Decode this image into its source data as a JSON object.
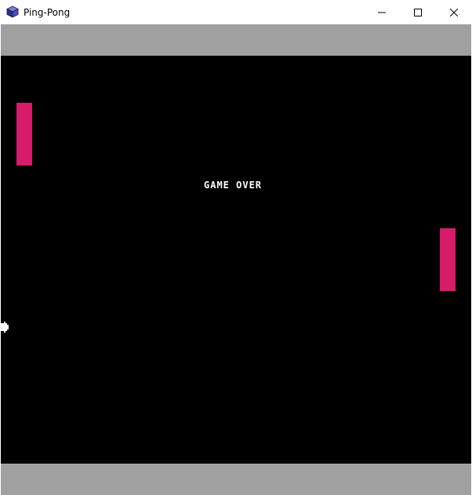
{
  "window": {
    "title": "Ping-Pong",
    "icon": "cube-app-icon"
  },
  "controls": {
    "minimize_icon": "minimize-icon",
    "maximize_icon": "maximize-icon",
    "close_icon": "close-icon"
  },
  "game": {
    "status_text": "GAME OVER",
    "colors": {
      "background": "#000000",
      "walls": "#a0a0a0",
      "paddles": "#d81b6a",
      "ball": "#ffffff",
      "text": "#ffffff"
    }
  }
}
